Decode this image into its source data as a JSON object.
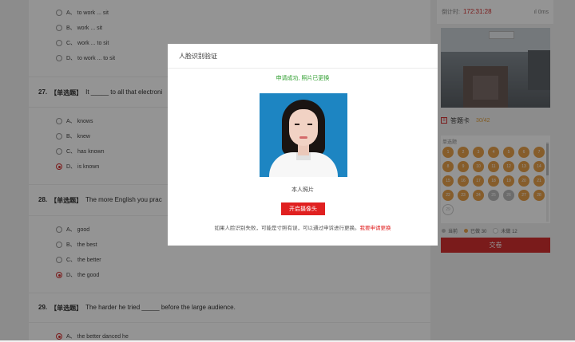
{
  "exam": {
    "q26_options": [
      {
        "letter": "A、",
        "text": "to work ... sit",
        "selected": false
      },
      {
        "letter": "B、",
        "text": "work ... sit",
        "selected": false
      },
      {
        "letter": "C、",
        "text": "work ... to sit",
        "selected": false
      },
      {
        "letter": "D、",
        "text": "to work ... to sit",
        "selected": false
      }
    ],
    "q27": {
      "number": "27.",
      "tag": "【单选题】",
      "stem": "It _____ to all that electroni"
    },
    "q27_options": [
      {
        "letter": "A、",
        "text": "knows",
        "selected": false
      },
      {
        "letter": "B、",
        "text": "knew",
        "selected": false
      },
      {
        "letter": "C、",
        "text": "has known",
        "selected": false
      },
      {
        "letter": "D、",
        "text": "is known",
        "selected": true
      }
    ],
    "q28": {
      "number": "28.",
      "tag": "【单选题】",
      "stem": "The more English you prac"
    },
    "q28_options": [
      {
        "letter": "A、",
        "text": "good",
        "selected": false
      },
      {
        "letter": "B、",
        "text": "the best",
        "selected": false
      },
      {
        "letter": "C、",
        "text": "the better",
        "selected": false
      },
      {
        "letter": "D、",
        "text": "the good",
        "selected": true
      }
    ],
    "q29": {
      "number": "29.",
      "tag": "【单选题】",
      "stem": "The harder he tried _____ before the large audience."
    },
    "q29_options": [
      {
        "letter": "A、",
        "text": "the better danced he",
        "selected": true
      }
    ]
  },
  "sidebar": {
    "timer_label": "倒计时:",
    "timer_value": "172:31:28",
    "network": "0ms",
    "card_title": "答题卡",
    "card_count": "30/42",
    "section_label": "单选题",
    "answered_numbers": [
      "1",
      "2",
      "3",
      "4",
      "5",
      "6",
      "7",
      "8",
      "9",
      "10",
      "11",
      "12",
      "13",
      "14",
      "15",
      "16",
      "17",
      "18",
      "19",
      "20",
      "21",
      "22",
      "23",
      "24"
    ],
    "partial_row": [
      {
        "n": "25",
        "state": "gray"
      },
      {
        "n": "26",
        "state": "gray"
      },
      {
        "n": "27",
        "state": "answered"
      },
      {
        "n": "28",
        "state": "answered"
      },
      {
        "n": "29",
        "state": "empty"
      }
    ],
    "legend": {
      "current": "当前",
      "answered": "已做",
      "answered_count": "30",
      "unanswered": "未做",
      "unanswered_count": "12"
    },
    "submit_label": "交卷",
    "colors": {
      "answered": "#e7a04a",
      "accent": "#d32f2f"
    }
  },
  "modal": {
    "title": "人脸识别验证",
    "success_message": "申请成功, 照片已更换",
    "photo_label": "本人照片",
    "camera_button": "开启摄像头",
    "notice_text": "如果人脸识别失败，可能是寸照有误，可以通过申诉进行更换。",
    "notice_link": "我要申请更换",
    "colors": {
      "success": "#2e9e2e",
      "danger": "#e02020",
      "photo_bg": "#1d85c2"
    }
  }
}
